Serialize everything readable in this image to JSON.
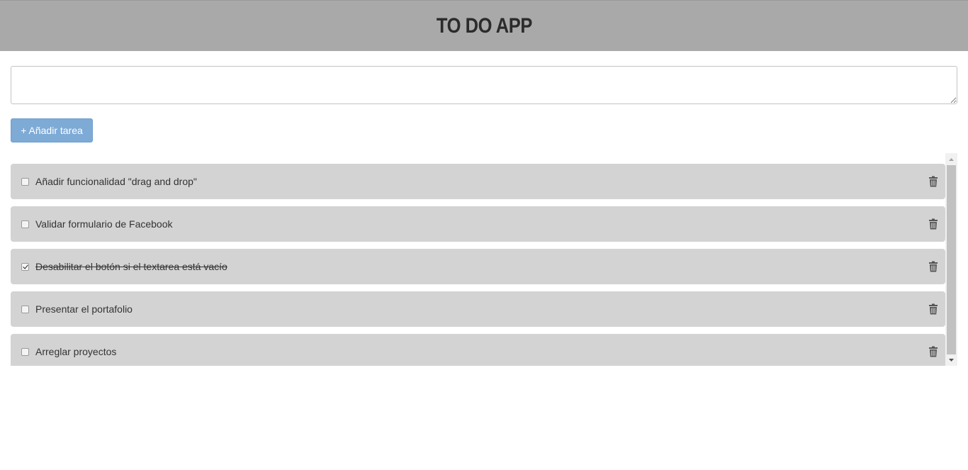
{
  "app": {
    "title": "TO DO APP"
  },
  "input": {
    "value": "",
    "placeholder": ""
  },
  "add_button": {
    "label": "+ Añadir tarea"
  },
  "tasks": [
    {
      "label": "Añadir funcionalidad \"drag and drop\"",
      "done": false
    },
    {
      "label": "Validar formulario de Facebook",
      "done": false
    },
    {
      "label": "Desabilitar el botón si el textarea está vacío",
      "done": true
    },
    {
      "label": "Presentar el portafolio",
      "done": false
    },
    {
      "label": "Arreglar proyectos",
      "done": false
    }
  ],
  "icons": {
    "delete": "trash-icon",
    "check": "checkbox"
  },
  "colors": {
    "header_bg": "#a9a9a9",
    "button_bg": "#7eaad6",
    "task_bg": "#d3d3d3"
  }
}
